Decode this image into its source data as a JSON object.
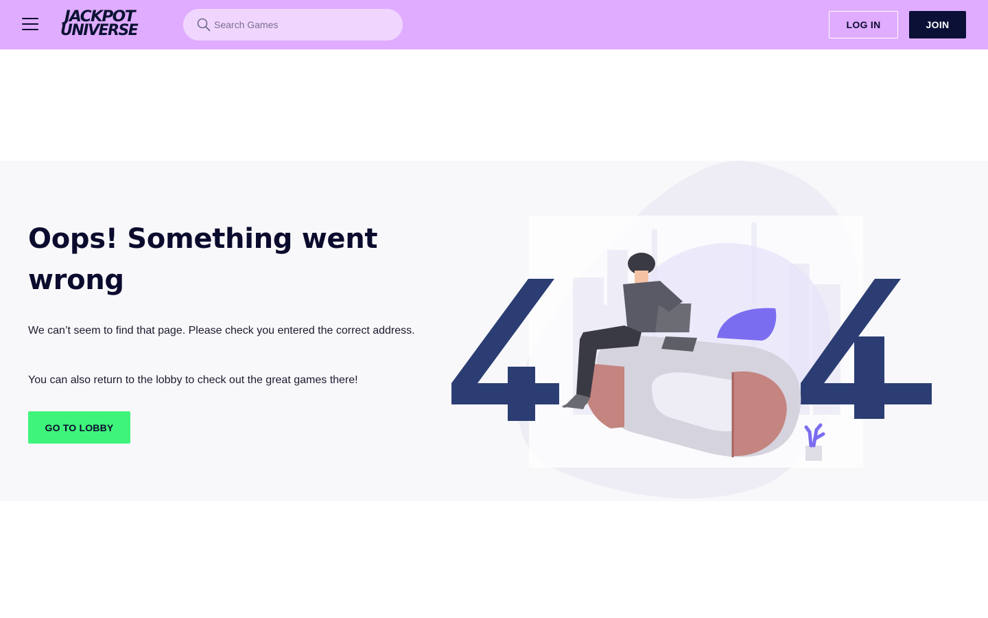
{
  "header": {
    "logo": {
      "line1": "JACKPOT",
      "line2": "UNIVERSE"
    },
    "search": {
      "placeholder": "Search Games",
      "value": ""
    },
    "login_label": "LOG IN",
    "join_label": "JOIN"
  },
  "error": {
    "headline": "Oops! Something went wrong",
    "message": "We can’t seem to find that page. Please check you entered the correct address.",
    "lobby_message": "You can also return to the lobby to check out the great games there!",
    "lobby_button": "GO TO LOBBY"
  },
  "illustration": {
    "left_digit": "4",
    "right_digit": "4"
  },
  "colors": {
    "header_bg": "#dfacff",
    "search_bg": "#f0d6ff",
    "join_bg": "#0a1036",
    "lobby_bg": "#3ff47b",
    "digit_color": "#2b3d73",
    "section_bg": "#f8f8fa"
  },
  "icons": {
    "menu": "hamburger-menu-icon",
    "search": "search-icon"
  }
}
